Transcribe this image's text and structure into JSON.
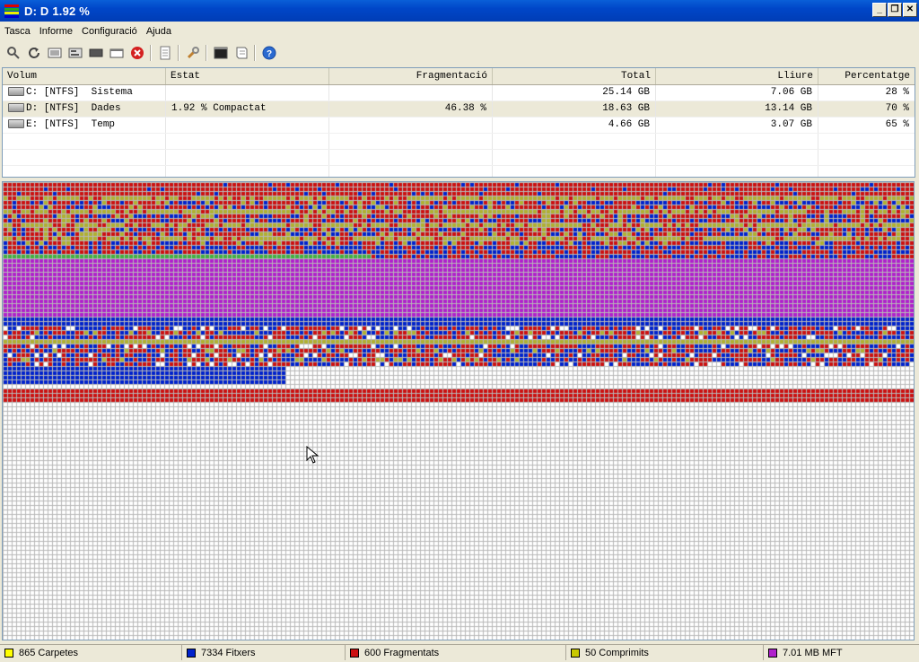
{
  "window": {
    "title": "D:  D   1.92 %",
    "buttons": {
      "minimize": "_",
      "restore": "❐",
      "close": "✕"
    }
  },
  "menu": [
    "Tasca",
    "Informe",
    "Configuració",
    "Ajuda"
  ],
  "toolbar": {
    "icons": [
      "analyze-icon",
      "refresh-icon",
      "defrag-icon",
      "optimize-icon",
      "stop-icon",
      "settings-icon",
      "cancel-icon",
      "report-icon",
      "config-icon",
      "console-icon",
      "script-icon",
      "help-icon"
    ]
  },
  "volumes": {
    "columns": [
      "Volum",
      "Estat",
      "Fragmentació",
      "Total",
      "Lliure",
      "Percentatge"
    ],
    "rows": [
      {
        "volum": "C: [NTFS]  Sistema",
        "estat": "",
        "frag": "",
        "total": "25.14 GB",
        "lliure": "7.06 GB",
        "pct": "28 %"
      },
      {
        "volum": "D: [NTFS]  Dades",
        "estat": "1.92 % Compactat",
        "frag": "46.38 %",
        "total": "18.63 GB",
        "lliure": "13.14 GB",
        "pct": "70 %"
      },
      {
        "volum": "E: [NTFS]  Temp",
        "estat": "",
        "frag": "",
        "total": "4.66 GB",
        "lliure": "3.07 GB",
        "pct": "65 %"
      }
    ]
  },
  "colors": {
    "free": "#ffffff",
    "fragmented": "#cc1010",
    "files": "#0022cc",
    "folders": "#d4d400",
    "compressed": "#b0b030",
    "mft": "#b020cc",
    "green": "#40b040",
    "grid": "#b8b8b8"
  },
  "status": [
    {
      "text": "865 Carpetes",
      "color": "#ffff00"
    },
    {
      "text": "7334 Fitxers",
      "color": "#0022cc"
    },
    {
      "text": "600 Fragmentats",
      "color": "#cc1010"
    },
    {
      "text": "50 Comprimits",
      "color": "#c8c800"
    },
    {
      "text": "7.01 MB MFT",
      "color": "#b020cc"
    }
  ]
}
